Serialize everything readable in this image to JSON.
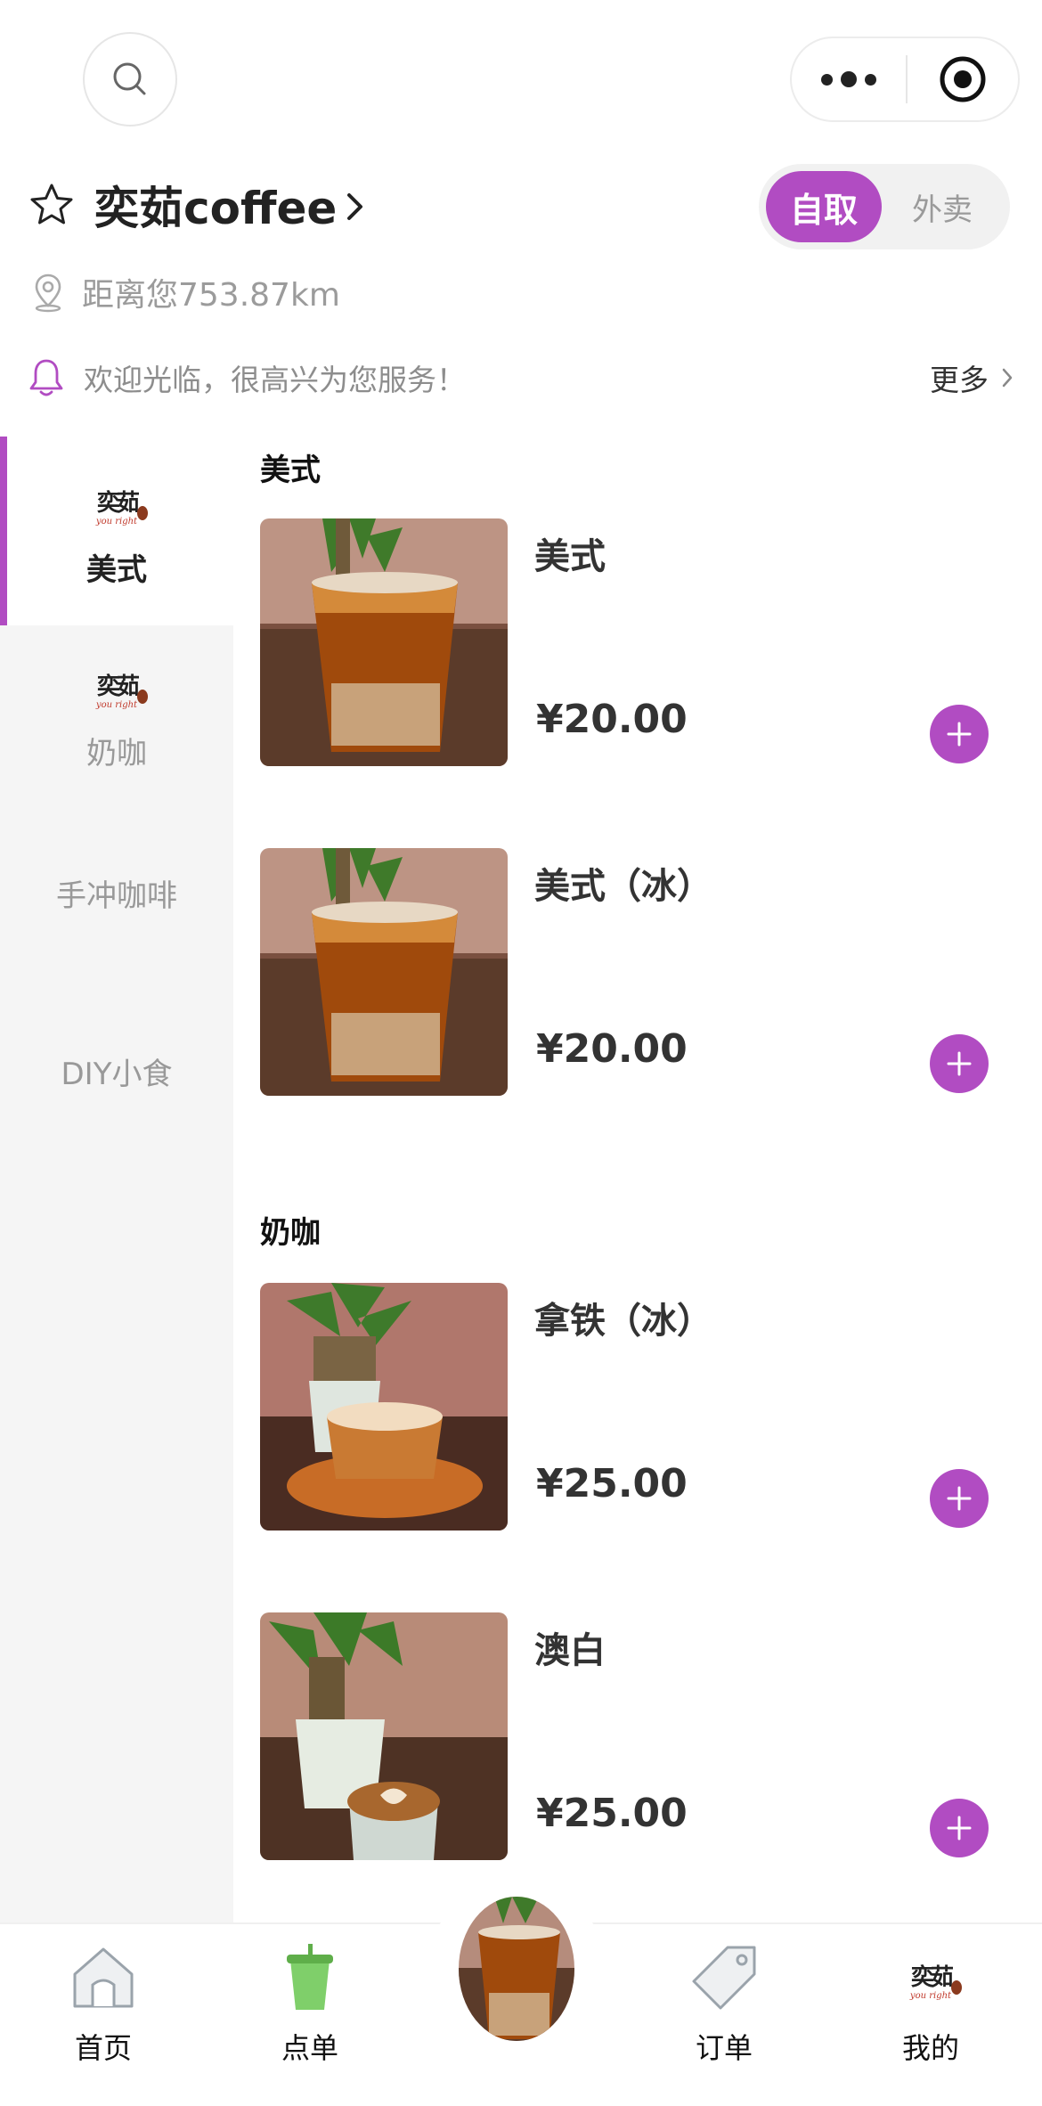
{
  "theme": {
    "accent": "#b14cc2"
  },
  "top_bar": {
    "search_icon": "search-icon",
    "menu_icon": "more-dots-icon",
    "close_icon": "target-icon"
  },
  "store": {
    "name": "奕茹coffee",
    "distance": "距离您753.87km"
  },
  "mode": {
    "pickup": "自取",
    "delivery": "外卖",
    "selected": "自取"
  },
  "notice": {
    "text": "欢迎光临，很高兴为您服务！",
    "more": "更多"
  },
  "sidebar": {
    "items": [
      {
        "label": "美式",
        "active": true,
        "logo": "奕茹"
      },
      {
        "label": "奶咖",
        "active": false,
        "logo": "奕茹"
      },
      {
        "label": "手冲咖啡",
        "active": false
      },
      {
        "label": "DIY小食",
        "active": false
      }
    ],
    "logo_en": "you right"
  },
  "sections": [
    {
      "title": "美式",
      "products": [
        {
          "name": "美式",
          "price": "¥20.00"
        },
        {
          "name": "美式（冰）",
          "price": "¥20.00"
        }
      ]
    },
    {
      "title": "奶咖",
      "products": [
        {
          "name": "拿铁（冰）",
          "price": "¥25.00"
        },
        {
          "name": "澳白",
          "price": "¥25.00"
        }
      ]
    }
  ],
  "tabbar": {
    "items": [
      {
        "label": "首页",
        "icon": "home-icon"
      },
      {
        "label": "点单",
        "icon": "drink-cup-icon"
      },
      {
        "label": "",
        "icon": "featured-coffee-image"
      },
      {
        "label": "订单",
        "icon": "tag-icon"
      },
      {
        "label": "我的",
        "icon": "brand-logo-icon"
      }
    ]
  }
}
